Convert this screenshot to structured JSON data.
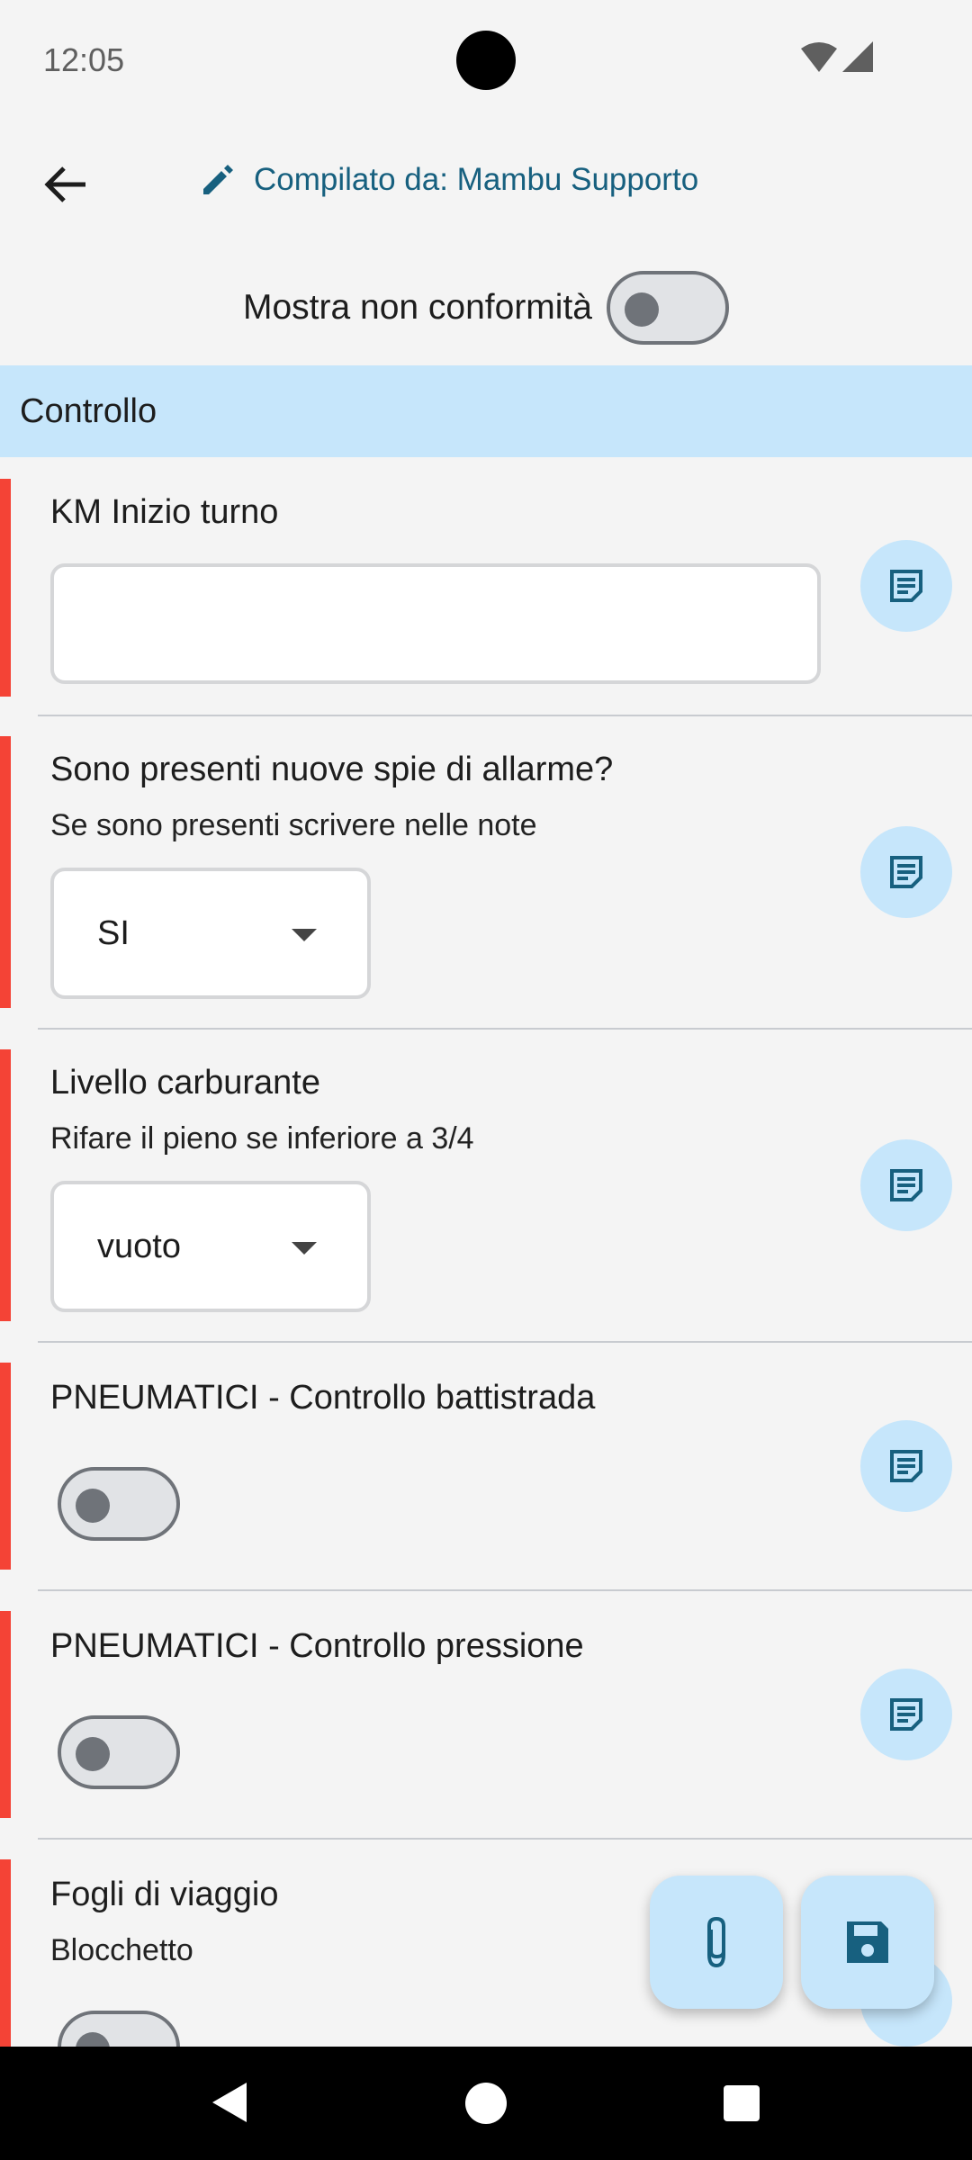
{
  "status": {
    "time": "12:05"
  },
  "app_bar": {
    "title": "Compilato da: Mambu Supporto"
  },
  "filter": {
    "label": "Mostra non conformità"
  },
  "section": {
    "title": "Controllo"
  },
  "items": [
    {
      "title": "KM Inizio turno",
      "subtitle": "",
      "type": "text",
      "value": ""
    },
    {
      "title": "Sono presenti nuove spie di allarme?",
      "subtitle": "Se sono presenti scrivere nelle note",
      "type": "select",
      "value": "SI"
    },
    {
      "title": "Livello carburante",
      "subtitle": "Rifare il pieno se inferiore a 3/4",
      "type": "select",
      "value": "vuoto"
    },
    {
      "title": "PNEUMATICI - Controllo battistrada",
      "subtitle": "",
      "type": "switch"
    },
    {
      "title": "PNEUMATICI - Controllo pressione",
      "subtitle": "",
      "type": "switch"
    },
    {
      "title": "Fogli di viaggio",
      "subtitle": "Blocchetto",
      "type": "switch"
    }
  ],
  "colors": {
    "accent": "#17607f",
    "light_blue": "#c6e6fb",
    "required": "#f44336"
  }
}
